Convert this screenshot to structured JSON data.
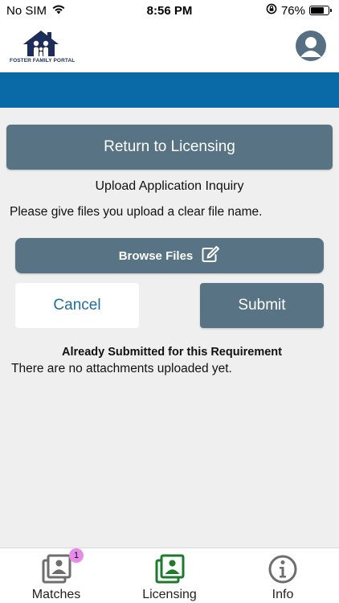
{
  "status_bar": {
    "carrier": "No SIM",
    "time": "8:56 PM",
    "battery": "76%",
    "battery_level": 0.76
  },
  "header": {
    "logo_text": "FOSTER FAMILY PORTAL",
    "profile_icon": "user-circle-icon"
  },
  "colors": {
    "accent_blue": "#0a6aa8",
    "button_slate": "#587384",
    "active_tab_green": "#1c7a2c",
    "badge_pink": "#e58ce8"
  },
  "main": {
    "return_button": "Return to Licensing",
    "upload_title": "Upload Application Inquiry",
    "upload_hint": "Please give files you upload a clear file name.",
    "browse_button": "Browse Files",
    "browse_icon": "edit-icon",
    "cancel_button": "Cancel",
    "submit_button": "Submit",
    "already_submitted_heading": "Already Submitted for this Requirement",
    "no_attachments_text": "There are no attachments uploaded yet."
  },
  "tabs": [
    {
      "label": "Matches",
      "icon": "photo-stack-icon",
      "badge": "1",
      "active": false
    },
    {
      "label": "Licensing",
      "icon": "photo-stack-icon",
      "active": true
    },
    {
      "label": "Info",
      "icon": "info-icon",
      "active": false
    }
  ]
}
